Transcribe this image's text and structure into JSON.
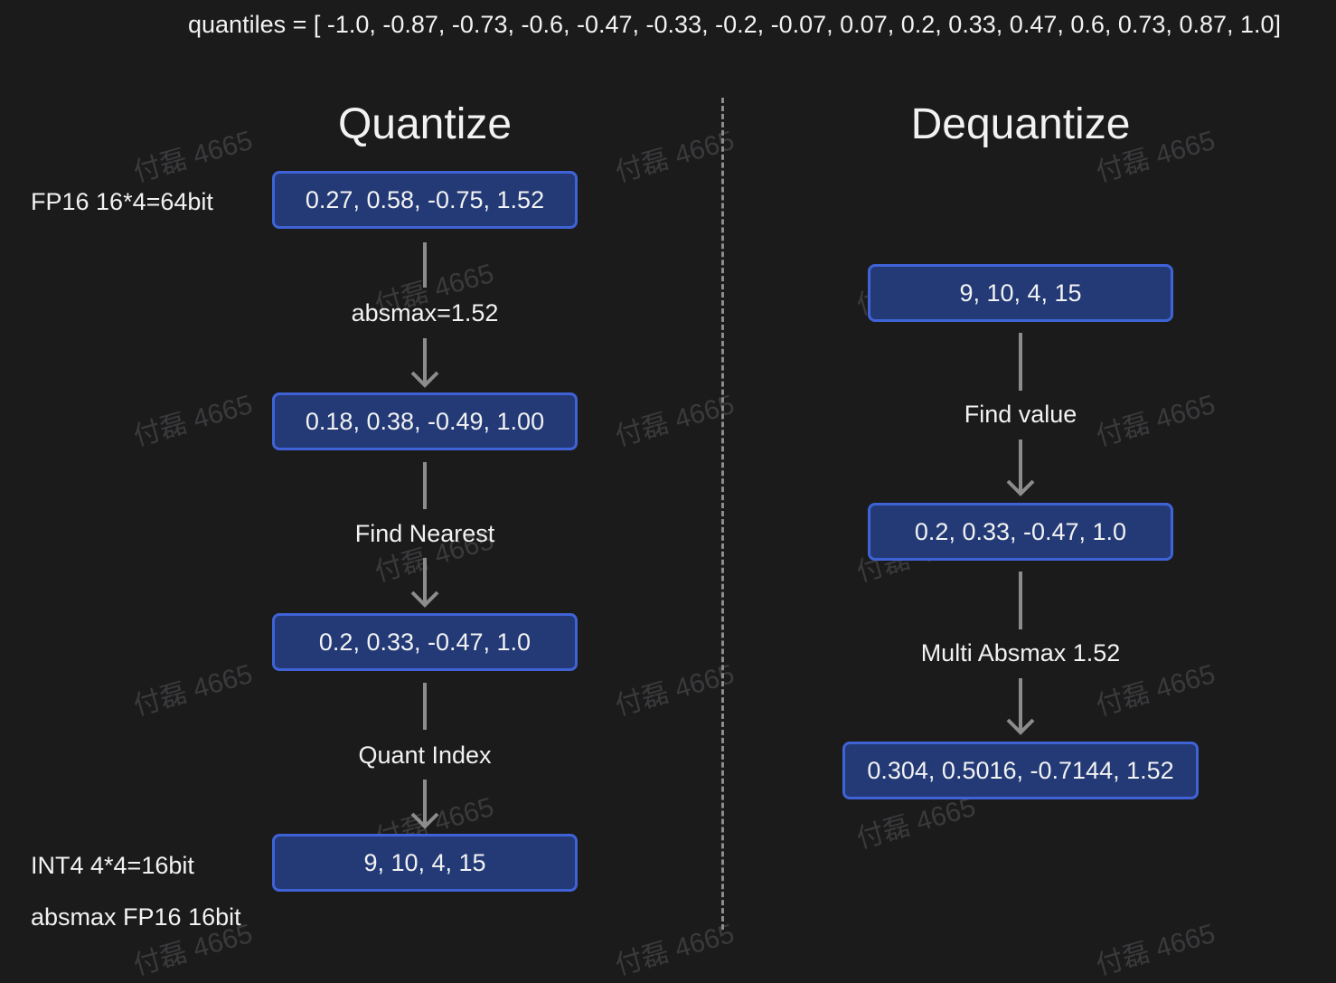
{
  "quantiles_text": "quantiles = [ -1.0, -0.87, -0.73, -0.6, -0.47, -0.33, -0.2, -0.07, 0.07, 0.2, 0.33, 0.47, 0.6, 0.73, 0.87, 1.0]",
  "watermark": "付磊 4665",
  "quantize": {
    "title": "Quantize",
    "fp16_label": "FP16 16*4=64bit",
    "box_input": "0.27, 0.58, -0.75, 1.52",
    "step_absmax": "absmax=1.52",
    "box_normalized": "0.18, 0.38, -0.49, 1.00",
    "step_find_nearest": "Find Nearest",
    "box_nearest": "0.2, 0.33, -0.47, 1.0",
    "step_quant_index": "Quant Index",
    "box_index": "9, 10, 4, 15",
    "int4_label": "INT4 4*4=16bit",
    "absmax_label": "absmax FP16 16bit"
  },
  "dequantize": {
    "title": "Dequantize",
    "box_index": "9, 10, 4, 15",
    "step_find_value": "Find value",
    "box_values": "0.2, 0.33, -0.47, 1.0",
    "step_multi_absmax": "Multi Absmax 1.52",
    "box_output": "0.304, 0.5016, -0.7144, 1.52"
  },
  "colors": {
    "background": "#1b1b1c",
    "box_fill": "#233a76",
    "box_border": "#3f63d6",
    "line": "#8c8c8c",
    "text": "#f2f2f2"
  }
}
